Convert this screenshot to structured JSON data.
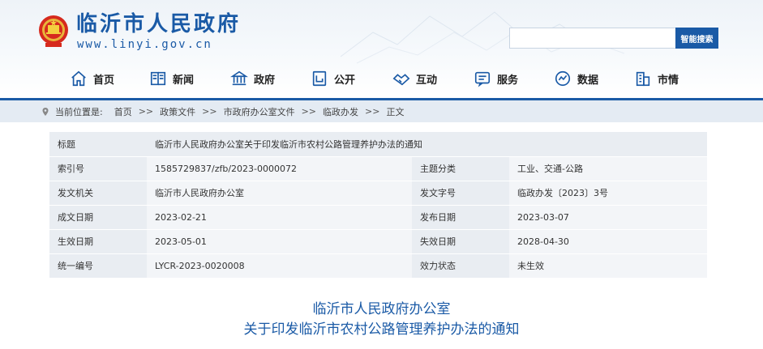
{
  "header": {
    "site_name": "临沂市人民政府",
    "site_url": "www.linyi.gov.cn",
    "search": {
      "placeholder": "",
      "button_label": "智能搜索"
    }
  },
  "nav": {
    "items": [
      {
        "label": "首页",
        "icon": "home-icon"
      },
      {
        "label": "新闻",
        "icon": "newspaper-icon"
      },
      {
        "label": "政府",
        "icon": "government-building-icon"
      },
      {
        "label": "公开",
        "icon": "open-document-icon"
      },
      {
        "label": "互动",
        "icon": "handshake-icon"
      },
      {
        "label": "服务",
        "icon": "service-icon"
      },
      {
        "label": "数据",
        "icon": "data-icon"
      },
      {
        "label": "市情",
        "icon": "city-icon"
      }
    ]
  },
  "breadcrumb": {
    "prefix": "当前位置是:",
    "items": [
      "首页",
      "政策文件",
      "市政府办公室文件",
      "临政办发",
      "正文"
    ],
    "separator": ">>"
  },
  "meta": {
    "title_label": "标题",
    "title_value": "临沂市人民政府办公室关于印发临沂市农村公路管理养护办法的通知",
    "rows": [
      {
        "l1": "索引号",
        "v1": "1585729837/zfb/2023-0000072",
        "l2": "主题分类",
        "v2": "工业、交通-公路"
      },
      {
        "l1": "发文机关",
        "v1": "临沂市人民政府办公室",
        "l2": "发文字号",
        "v2": "临政办发〔2023〕3号"
      },
      {
        "l1": "成文日期",
        "v1": "2023-02-21",
        "l2": "发布日期",
        "v2": "2023-03-07"
      },
      {
        "l1": "生效日期",
        "v1": "2023-05-01",
        "l2": "失效日期",
        "v2": "2028-04-30"
      },
      {
        "l1": "统一编号",
        "v1": "LYCR-2023-0020008",
        "l2": "效力状态",
        "v2": "未生效"
      }
    ]
  },
  "document": {
    "title_line1": "临沂市人民政府办公室",
    "title_line2": "关于印发临沂市农村公路管理养护办法的通知"
  },
  "colors": {
    "brand": "#1a5aa6",
    "breadcrumb_bg": "#e4ebf3",
    "table_label_bg": "#e9edf2",
    "table_value_bg": "#f3f5f8"
  }
}
